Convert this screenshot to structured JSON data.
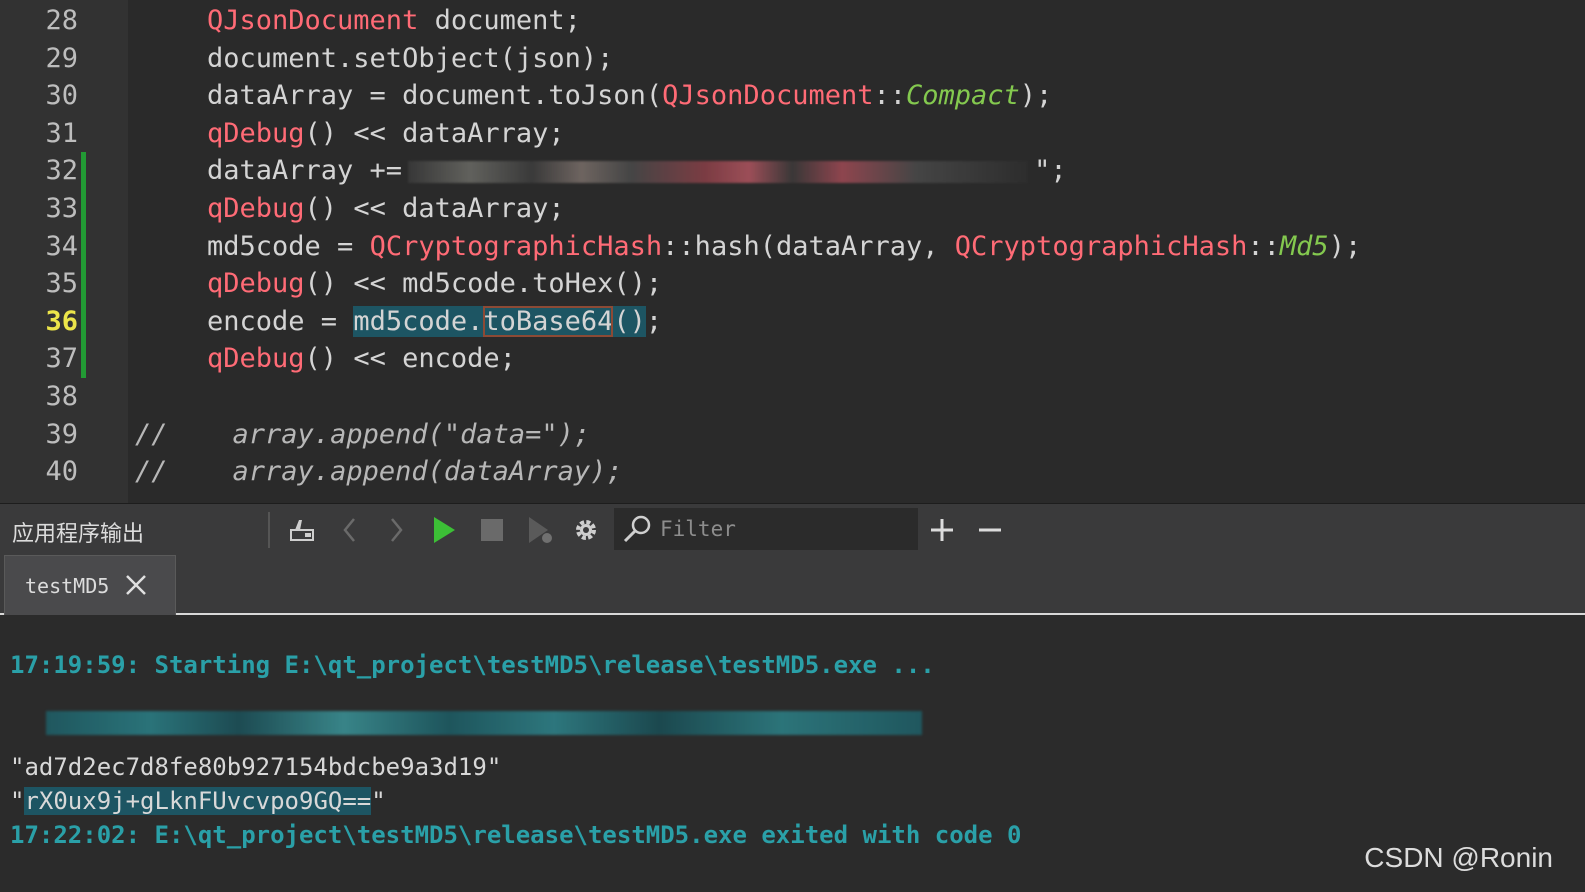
{
  "editor": {
    "lines": [
      {
        "num": "28",
        "parts": [
          {
            "t": "QJsonDocument",
            "c": "kw-class"
          },
          {
            "t": " document;"
          }
        ]
      },
      {
        "num": "29",
        "parts": [
          {
            "t": "document.setObject(json);"
          }
        ]
      },
      {
        "num": "30",
        "parts": [
          {
            "t": "dataArray = document.toJson("
          },
          {
            "t": "QJsonDocument",
            "c": "kw-class"
          },
          {
            "t": "::"
          },
          {
            "t": "Compact",
            "c": "enum"
          },
          {
            "t": ");"
          }
        ]
      },
      {
        "num": "31",
        "parts": [
          {
            "t": "qDebug",
            "c": "kw-class"
          },
          {
            "t": "() << dataArray;"
          }
        ]
      },
      {
        "num": "32",
        "parts": [
          {
            "t": "dataArray +="
          },
          {
            "t": "",
            "c": "redacted"
          },
          {
            "t": "\";"
          }
        ]
      },
      {
        "num": "33",
        "parts": [
          {
            "t": "qDebug",
            "c": "kw-class"
          },
          {
            "t": "() << dataArray;"
          }
        ]
      },
      {
        "num": "34",
        "parts": [
          {
            "t": "md5code = "
          },
          {
            "t": "QCryptographicHash",
            "c": "kw-class"
          },
          {
            "t": "::hash(dataArray, "
          },
          {
            "t": "QCryptographicHash",
            "c": "kw-class"
          },
          {
            "t": "::"
          },
          {
            "t": "Md5",
            "c": "enum"
          },
          {
            "t": ");"
          }
        ]
      },
      {
        "num": "35",
        "parts": [
          {
            "t": "qDebug",
            "c": "kw-class"
          },
          {
            "t": "() << md5code.toHex();"
          }
        ]
      },
      {
        "num": "36",
        "parts": [
          {
            "t": "encode = "
          },
          {
            "t": "md5code.",
            "c": "sel"
          },
          {
            "t": "toBase64",
            "c": "sel paren-match"
          },
          {
            "t": "()",
            "c": "sel"
          },
          {
            "t": ";"
          }
        ]
      },
      {
        "num": "37",
        "parts": [
          {
            "t": "qDebug",
            "c": "kw-class"
          },
          {
            "t": "() << encode;"
          }
        ]
      },
      {
        "num": "38",
        "parts": []
      },
      {
        "num": "39",
        "parts": [
          {
            "t": "//    array.append(\"data=\");",
            "c": "comment"
          }
        ]
      },
      {
        "num": "40",
        "parts": [
          {
            "t": "//    array.append(dataArray);",
            "c": "comment"
          }
        ]
      }
    ]
  },
  "toolbar": {
    "title": "应用程序输出",
    "filter_placeholder": "Filter",
    "icons": [
      "clear-output-icon",
      "previous-icon",
      "next-icon",
      "run-icon",
      "stop-icon",
      "attach-debugger-icon",
      "settings-icon",
      "search-icon",
      "zoom-in-icon",
      "zoom-out-icon"
    ]
  },
  "tab": {
    "label": "testMD5"
  },
  "output": {
    "start_line": "17:19:59: Starting E:\\qt_project\\testMD5\\release\\testMD5.exe ...",
    "hex_line": "\"ad7d2ec7d8fe80b927154bdcbe9a3d19\"",
    "base64_quote_open": "\"",
    "base64_value": "rX0ux9j+gLknFUvcvpo9GQ==",
    "base64_quote_close": "\"",
    "exit_line": "17:22:02: E:\\qt_project\\testMD5\\release\\testMD5.exe exited with code 0"
  },
  "watermark": "CSDN @Ronin",
  "colors": {
    "class": "#ff6b76",
    "enum": "#84c94f",
    "system_output": "#2aa0a8",
    "current_line_number": "#ece54a",
    "change_marker": "#229a34"
  }
}
